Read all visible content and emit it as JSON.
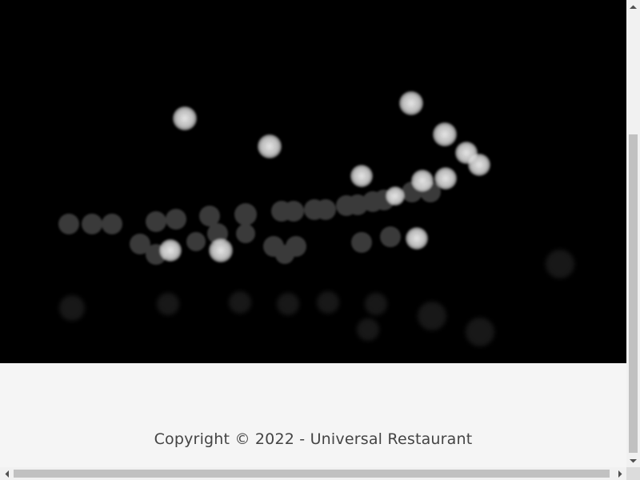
{
  "hero": {
    "image": "bokeh-lights-night",
    "background_color": "#000000"
  },
  "footer": {
    "copyright": "Copyright © 2022 - Universal Restaurant",
    "background_color": "#f5f5f5",
    "text_color": "#444444"
  },
  "scrollbars": {
    "vertical": {
      "up_icon": "chevron-up-icon",
      "down_icon": "chevron-down-icon"
    },
    "horizontal": {
      "left_icon": "chevron-left-icon",
      "right_icon": "chevron-right-icon"
    }
  }
}
